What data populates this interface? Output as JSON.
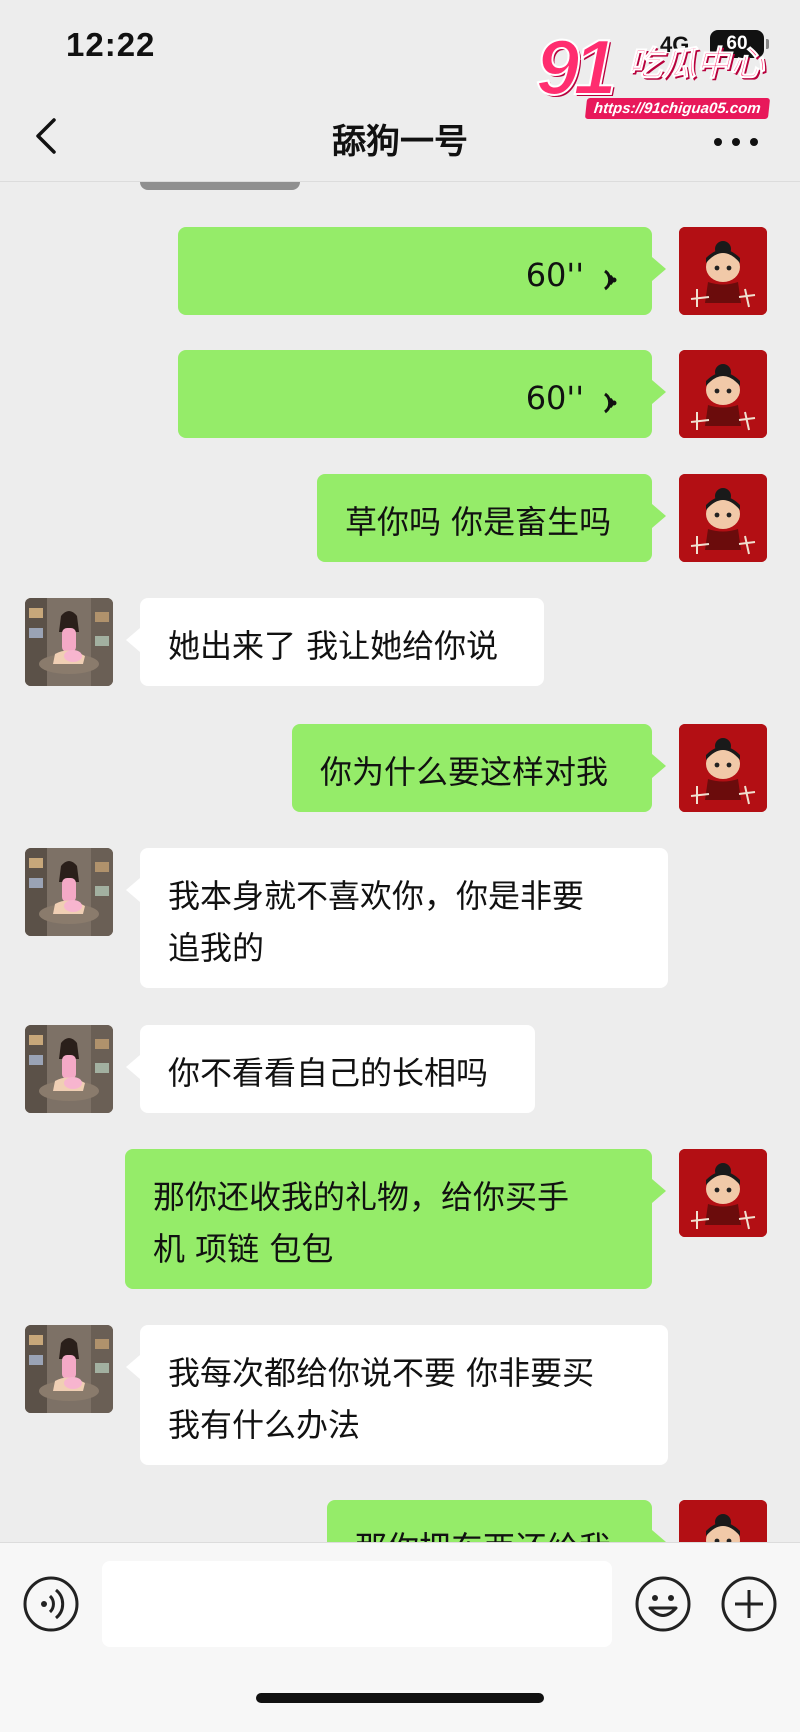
{
  "status_bar": {
    "time": "12:22",
    "network": "4G",
    "battery": "60"
  },
  "watermark": {
    "number": "91",
    "name": "吃瓜中心",
    "url": "https://91chigua05.com"
  },
  "header": {
    "title": "舔狗一号"
  },
  "messages": [
    {
      "sender": "self",
      "type": "voice",
      "duration": "60''"
    },
    {
      "sender": "self",
      "type": "voice",
      "duration": "60''"
    },
    {
      "sender": "self",
      "type": "text",
      "text": "草你吗 你是畜生吗"
    },
    {
      "sender": "other",
      "type": "text",
      "text": "她出来了 我让她给你说"
    },
    {
      "sender": "self",
      "type": "text",
      "text": "你为什么要这样对我"
    },
    {
      "sender": "other",
      "type": "text",
      "lines": [
        "我本身就不喜欢你，你是非要",
        "追我的"
      ]
    },
    {
      "sender": "other",
      "type": "text",
      "text": "你不看看自己的长相吗"
    },
    {
      "sender": "self",
      "type": "text",
      "lines": [
        "那你还收我的礼物，给你买手",
        "机 项链 包包"
      ]
    },
    {
      "sender": "other",
      "type": "text",
      "lines": [
        "我每次都给你说不要 你非要买",
        "我有什么办法"
      ]
    },
    {
      "sender": "self",
      "type": "text",
      "text": "那你把东西还给我"
    }
  ],
  "icons": {
    "back": "chevron-left-icon",
    "more": "more-dots-icon",
    "voice": "voice-wave-icon",
    "voice_input": "voice-input-icon",
    "emoji": "emoji-icon",
    "add": "plus-circle-icon"
  },
  "colors": {
    "self_bubble": "#95ec69",
    "other_bubble": "#ffffff",
    "background": "#ededed"
  }
}
